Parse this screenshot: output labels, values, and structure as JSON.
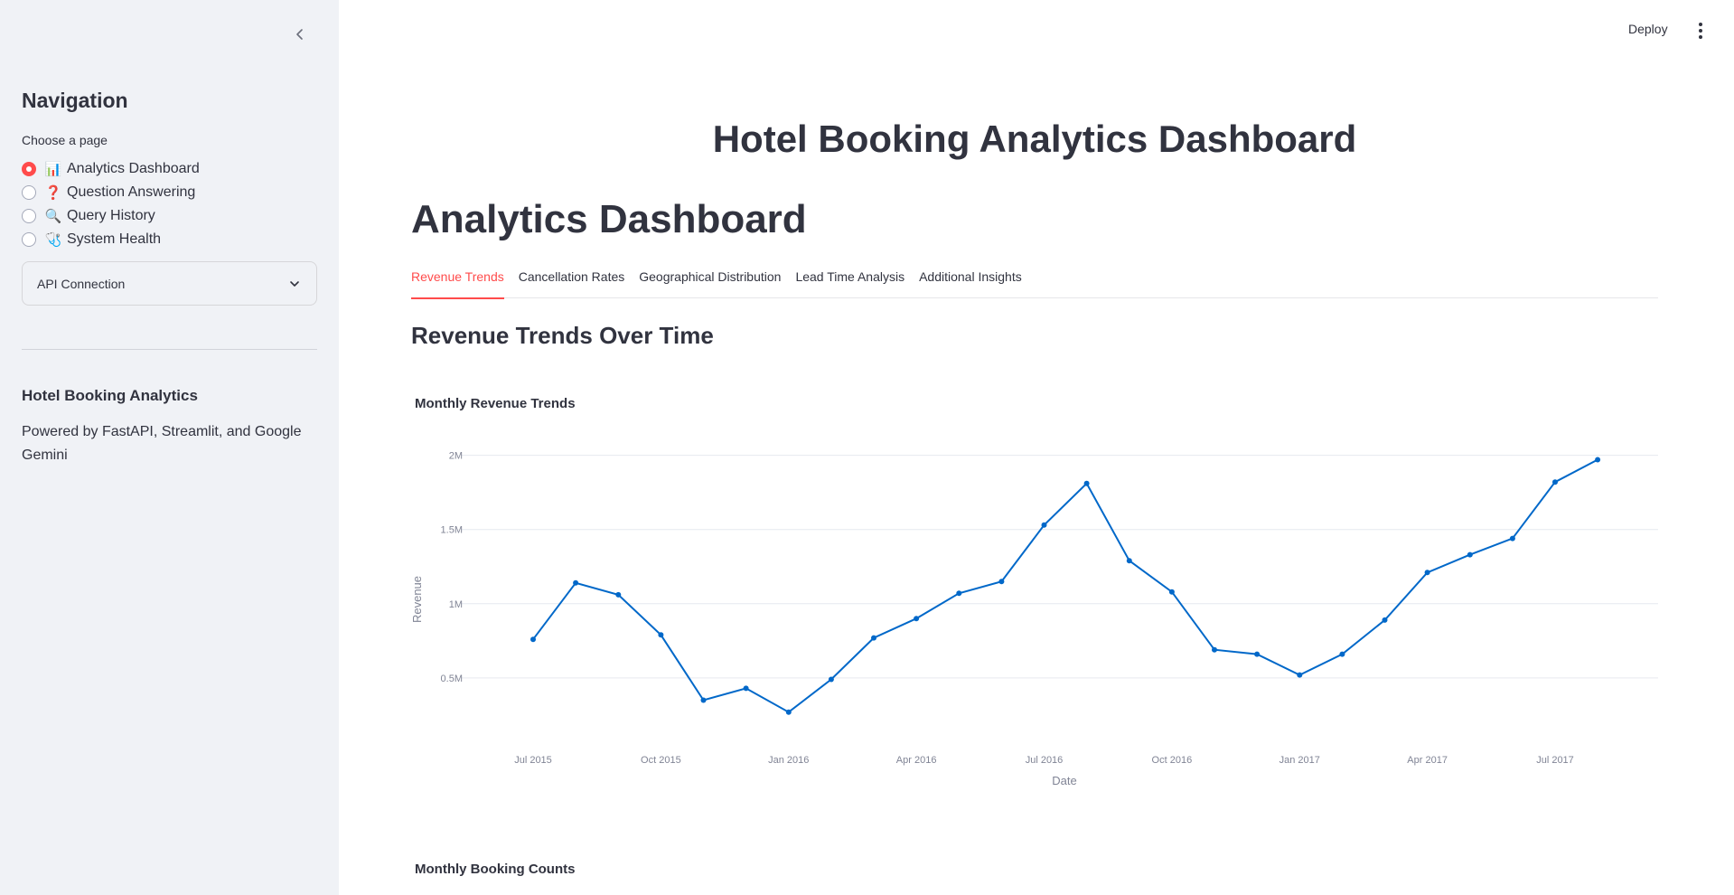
{
  "sidebar": {
    "heading": "Navigation",
    "choose_label": "Choose a page",
    "pages": [
      {
        "emoji": "📊",
        "label": "Analytics Dashboard",
        "selected": true
      },
      {
        "emoji": "❓",
        "label": "Question Answering",
        "selected": false
      },
      {
        "emoji": "🔍",
        "label": "Query History",
        "selected": false
      },
      {
        "emoji": "🩺",
        "label": "System Health",
        "selected": false
      }
    ],
    "expander_label": "API Connection",
    "app_title": "Hotel Booking Analytics",
    "powered_by": "Powered by FastAPI, Streamlit, and Google Gemini"
  },
  "toolbar": {
    "deploy_label": "Deploy"
  },
  "main": {
    "title": "Hotel Booking Analytics Dashboard",
    "page_title": "Analytics Dashboard",
    "tabs": [
      {
        "label": "Revenue Trends",
        "active": true
      },
      {
        "label": "Cancellation Rates",
        "active": false
      },
      {
        "label": "Geographical Distribution",
        "active": false
      },
      {
        "label": "Lead Time Analysis",
        "active": false
      },
      {
        "label": "Additional Insights",
        "active": false
      }
    ],
    "section_title": "Revenue Trends Over Time",
    "chart_title": "Monthly Revenue Trends",
    "next_chart_title": "Monthly Booking Counts"
  },
  "colors": {
    "accent": "#ff4b4b",
    "series": "#0068c9",
    "sidebar_bg": "#f0f2f6"
  },
  "chart_data": {
    "type": "line",
    "xlabel": "Date",
    "ylabel": "Revenue",
    "x": [
      "2015-07",
      "2015-08",
      "2015-09",
      "2015-10",
      "2015-11",
      "2015-12",
      "2016-01",
      "2016-02",
      "2016-03",
      "2016-04",
      "2016-05",
      "2016-06",
      "2016-07",
      "2016-08",
      "2016-09",
      "2016-10",
      "2016-11",
      "2016-12",
      "2017-01",
      "2017-02",
      "2017-03",
      "2017-04",
      "2017-05",
      "2017-06",
      "2017-07",
      "2017-08"
    ],
    "values": [
      760000,
      1140000,
      1060000,
      790000,
      350000,
      430000,
      270000,
      490000,
      770000,
      900000,
      1070000,
      1150000,
      1530000,
      1810000,
      1290000,
      1080000,
      690000,
      660000,
      520000,
      660000,
      890000,
      1210000,
      1330000,
      1440000,
      1820000,
      1970000
    ],
    "x_ticks": [
      "Jul 2015",
      "Oct 2015",
      "Jan 2016",
      "Apr 2016",
      "Jul 2016",
      "Oct 2016",
      "Jan 2017",
      "Apr 2017",
      "Jul 2017"
    ],
    "y_ticks": [
      "0.5M",
      "1M",
      "1.5M",
      "2M"
    ],
    "y_tick_values": [
      500000,
      1000000,
      1500000,
      2000000
    ],
    "ylim": [
      0,
      2100000
    ],
    "grid": true,
    "markers": true
  }
}
